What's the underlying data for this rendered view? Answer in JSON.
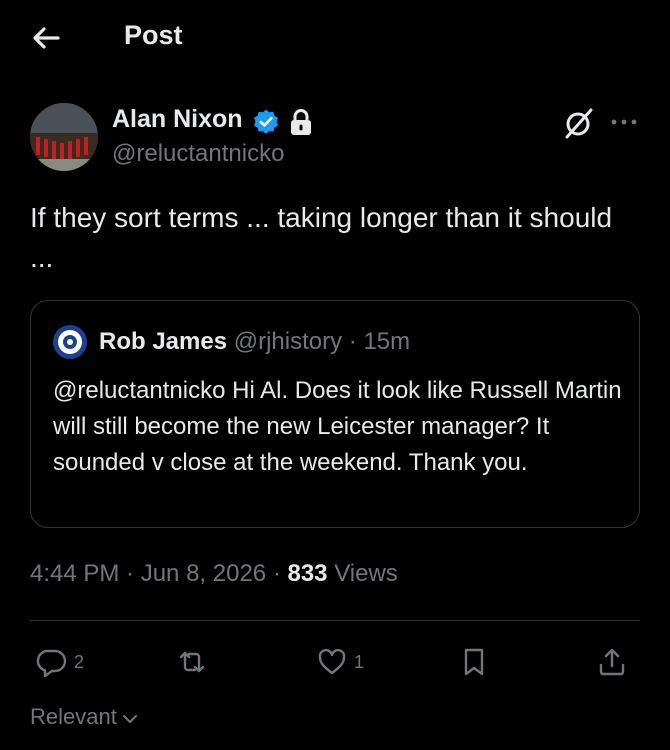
{
  "header": {
    "title": "Post",
    "back_icon": "arrow-left-icon"
  },
  "post": {
    "author_name": "Alan Nixon",
    "handle": "@reluctantnicko",
    "verified_color": "#1d9bf0",
    "text": "If they sort terms ... taking longer than it should ...",
    "timestamp": "4:44 PM · Jun 8, 2026 ·",
    "views_count": "833",
    "views_label": "Views"
  },
  "quote": {
    "author_name": "Rob James",
    "meta": "@rjhistory · 15m",
    "text": "@reluctantnicko Hi Al. Does it look like Russell Martin will still become the new Leicester manager? It sounded v close at the weekend. Thank you."
  },
  "actions": {
    "reply_count": "2",
    "repost_count": "",
    "like_count": "1"
  },
  "sort": {
    "label": "Relevant"
  },
  "colors": {
    "background": "#000000",
    "text": "#e7e9ea",
    "muted": "#71767b",
    "border": "#333639",
    "accent": "#1d9bf0"
  }
}
